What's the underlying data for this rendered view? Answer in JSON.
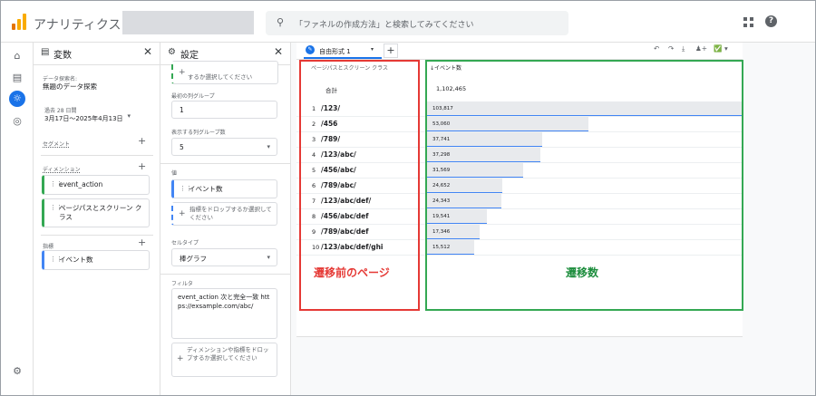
{
  "app": {
    "title": "アナリティクス",
    "search_placeholder": "「ファネルの作成方法」と検索してみてください",
    "help": "?"
  },
  "rail": {
    "icons": [
      "home-icon",
      "reports-icon",
      "explore-icon",
      "advertising-icon",
      "settings-icon"
    ]
  },
  "variables": {
    "title": "変数",
    "exploration_name_label": "データ探索名:",
    "exploration_name": "無題のデータ探索",
    "date_custom": "過去 28 日間",
    "date_range": "3月17日～2025年4月13日",
    "segments_label": "セグメント",
    "dimensions_label": "ディメンション",
    "dimensions": [
      "event_action",
      "ページパスとスクリーン クラス"
    ],
    "metrics_label": "指標",
    "metrics": [
      "イベント数"
    ]
  },
  "settings": {
    "title": "設定",
    "drop_partial": "するか選択してください",
    "first_row_group_label": "最初の列グループ",
    "first_row_group_value": "1",
    "show_rows_label": "表示する列グループ数",
    "show_rows_value": "5",
    "values_label": "値",
    "value_metric": "イベント数",
    "drop_metric": "指標をドロップするか選択してください",
    "cell_type_label": "セルタイプ",
    "cell_type_value": "棒グラフ",
    "filter_label": "フィルタ",
    "filter_text": "event_action 次と完全一致 https://exsample.com/abc/",
    "drop_dimension": "ディメンションや指標をドロップするか選択してください"
  },
  "canvas": {
    "tab_label": "自由形式 1",
    "col_dimension": "ページパスとスクリーン クラス",
    "col_metric": "↓イベント数",
    "total_label": "合計",
    "total_value": "1,102,465",
    "rows": [
      {
        "n": "1",
        "path": "/123/",
        "value": "103,817",
        "num": 103817
      },
      {
        "n": "2",
        "path": "/456",
        "value": "53,060",
        "num": 53060
      },
      {
        "n": "3",
        "path": "/789/",
        "value": "37,741",
        "num": 37741
      },
      {
        "n": "4",
        "path": "/123/abc/",
        "value": "37,298",
        "num": 37298
      },
      {
        "n": "5",
        "path": "/456/abc/",
        "value": "31,569",
        "num": 31569
      },
      {
        "n": "6",
        "path": "/789/abc/",
        "value": "24,652",
        "num": 24652
      },
      {
        "n": "7",
        "path": "/123/abc/def/",
        "value": "24,343",
        "num": 24343
      },
      {
        "n": "8",
        "path": "/456/abc/def",
        "value": "19,541",
        "num": 19541
      },
      {
        "n": "9",
        "path": "/789/abc/def",
        "value": "17,346",
        "num": 17346
      },
      {
        "n": "10",
        "path": "/123/abc/def/ghi",
        "value": "15,512",
        "num": 15512
      }
    ],
    "annotation_red": "遷移前のページ",
    "annotation_green": "遷移数"
  },
  "colors": {
    "accent": "#1a73e8",
    "annotation_red": "#e53935",
    "annotation_green": "#34a853"
  }
}
